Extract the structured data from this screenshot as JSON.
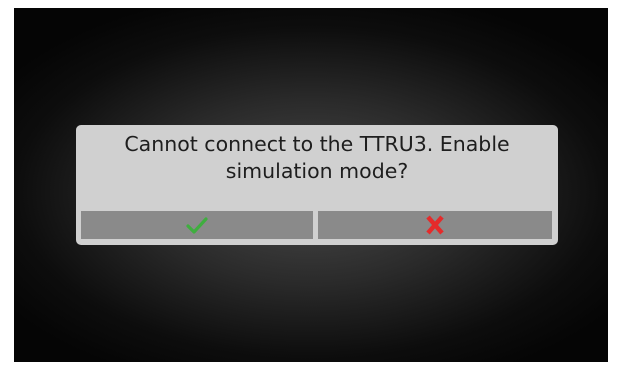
{
  "dialog": {
    "message": "Cannot connect to the TTRU3. Enable simulation mode?",
    "confirm_icon": "checkmark-icon",
    "cancel_icon": "x-icon"
  },
  "colors": {
    "dialog_background": "#d0d0d0",
    "button_background": "#8a8a8a",
    "confirm_icon": "#3fae3f",
    "cancel_icon": "#e52b2b"
  }
}
